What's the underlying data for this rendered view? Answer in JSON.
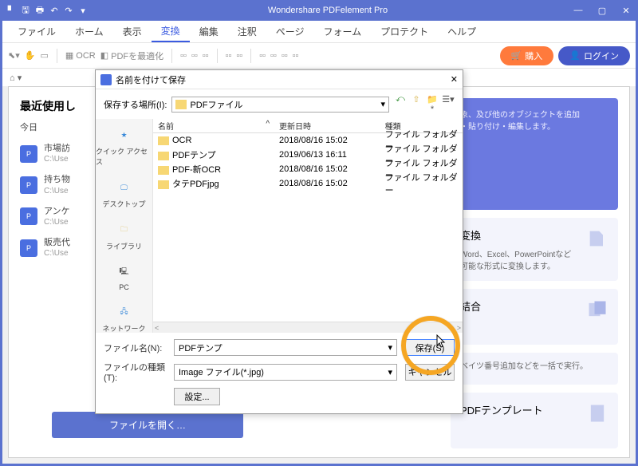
{
  "titlebar": {
    "title": "Wondershare PDFelement Pro"
  },
  "menu": {
    "items": [
      "ファイル",
      "ホーム",
      "表示",
      "変換",
      "編集",
      "注釈",
      "ページ",
      "フォーム",
      "プロテクト",
      "ヘルプ"
    ],
    "active": 3
  },
  "toolbar": {
    "ocr": "OCR",
    "optimize": "PDFを最適化",
    "buy": "購入",
    "login": "ログイン"
  },
  "recent": {
    "heading": "最近使用し",
    "day": "今日",
    "items": [
      {
        "name": "市場訪",
        "path": "C:\\Use"
      },
      {
        "name": "持ち物",
        "path": "C:\\Use"
      },
      {
        "name": "アンケ",
        "path": "C:\\Use"
      },
      {
        "name": "販売代",
        "path": "C:\\Use"
      }
    ]
  },
  "cards": {
    "edit": {
      "desc1": "象、及び他のオブジェクトを追加",
      "desc2": "・貼り付け・編集します。"
    },
    "convert": {
      "title": "変換",
      "desc1": "Word、Excel、PowerPointなど",
      "desc2": "可能な形式に変換します。"
    },
    "combine": {
      "title": "結合"
    },
    "batch": {
      "desc": "ベイツ番号追加などを一括で実行。"
    },
    "template": {
      "title": "PDFテンプレート"
    }
  },
  "open_btn": "ファイルを開く…",
  "modal": {
    "title": "名前を付けて保存",
    "location_label": "保存する場所(I):",
    "location_value": "PDFファイル",
    "columns": {
      "name": "名前",
      "date": "更新日時",
      "type": "種類"
    },
    "rows": [
      {
        "name": "OCR",
        "date": "2018/08/16 15:02",
        "type": "ファイル フォルダー"
      },
      {
        "name": "PDFテンプ",
        "date": "2019/06/13 16:11",
        "type": "ファイル フォルダー"
      },
      {
        "name": "PDF-新OCR",
        "date": "2018/08/16 15:02",
        "type": "ファイル フォルダー"
      },
      {
        "name": "タテPDFjpg",
        "date": "2018/08/16 15:02",
        "type": "ファイル フォルダー"
      }
    ],
    "places": {
      "quick": "クイック アクセス",
      "desktop": "デスクトップ",
      "library": "ライブラリ",
      "pc": "PC",
      "network": "ネットワーク"
    },
    "filename_label": "ファイル名(N):",
    "filename_value": "PDFテンプ",
    "filetype_label": "ファイルの種類(T):",
    "filetype_value": "Image ファイル(*.jpg)",
    "save": "保存(S)",
    "cancel": "キャンセル",
    "settings": "設定..."
  }
}
